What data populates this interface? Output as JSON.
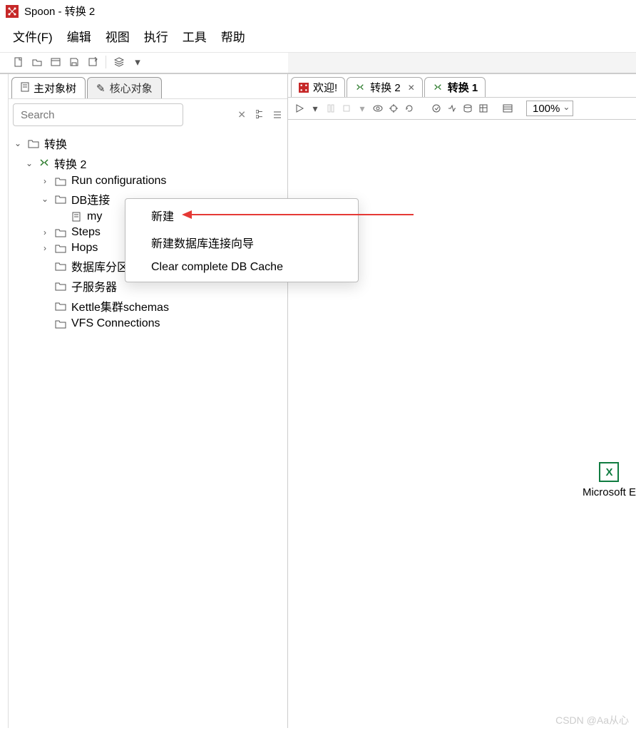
{
  "title": "Spoon - 转换 2",
  "menu": [
    "文件(F)",
    "编辑",
    "视图",
    "执行",
    "工具",
    "帮助"
  ],
  "left_tabs": {
    "active": "主对象树",
    "inactive": "核心对象"
  },
  "search": {
    "placeholder": "Search"
  },
  "tree": {
    "root": "转换",
    "child": "转换 2",
    "items": {
      "run_cfg": "Run configurations",
      "db_conn": "DB连接",
      "db_child": "my",
      "steps": "Steps",
      "hops": "Hops",
      "db_schemas": "数据库分区schemas",
      "sub_servers": "子服务器",
      "kettle_cluster": "Kettle集群schemas",
      "vfs": "VFS Connections"
    }
  },
  "editor_tabs": {
    "welcome": "欢迎!",
    "t2": "转换 2",
    "t1": "转换 1"
  },
  "zoom": "100%",
  "context_menu": {
    "new": "新建",
    "wizard": "新建数据库连接向导",
    "clear": "Clear complete DB Cache"
  },
  "excel_label": "Microsoft E",
  "excel_badge": "X",
  "watermark": "CSDN @Aa从心"
}
